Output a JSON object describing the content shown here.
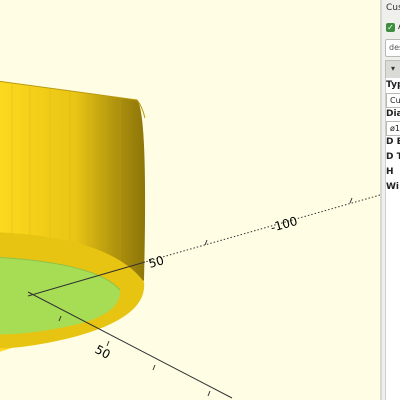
{
  "viewport": {
    "axis_labels": {
      "label_50_x": "50",
      "label_50_y": "50",
      "label_100_neg": "-100"
    },
    "colors": {
      "background": "#fffee5",
      "body": "#e6c617",
      "inner": "#a6dd55"
    }
  },
  "customizer": {
    "title": "Cus",
    "auto_preview": {
      "checked": true,
      "label": "A"
    },
    "preset_placeholder": "des",
    "params": [
      {
        "label": "Typ",
        "value": "Cu"
      },
      {
        "label": "Dia",
        "value": "ø1"
      },
      {
        "label": "D E",
        "value": ""
      },
      {
        "label": "D T",
        "value": ""
      },
      {
        "label": "H",
        "value": ""
      },
      {
        "label": "Wi",
        "value": ""
      }
    ]
  }
}
